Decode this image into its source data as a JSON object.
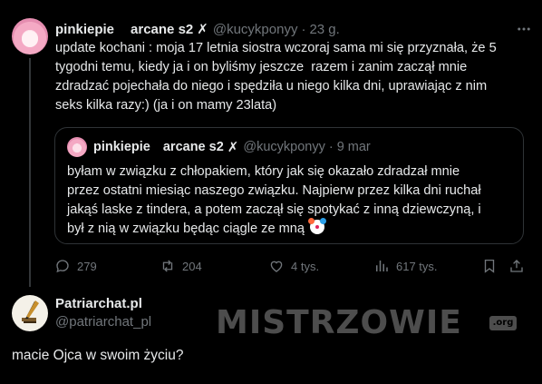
{
  "tweet": {
    "author_name": "pinkiepie",
    "author_alias": "arcane s2",
    "x_mark": "✗",
    "handle": "@kucykponyy",
    "separator": "·",
    "time": "23 g.",
    "text": "update kochani : moja 17 letnia siostra wczoraj sama mi się przyznała, że 5\ntygodni temu, kiedy ja i on byliśmy jeszcze  razem i zanim zaczął mnie\nzdradzać pojechała do niego i spędziła u niego kilka dni, uprawiając z nim\nseks kilka razy:) (ja i on mamy 23lata)",
    "quote": {
      "author_name": "pinkiepie",
      "author_alias": "arcane s2",
      "x_mark": "✗",
      "handle": "@kucykponyy",
      "separator": "·",
      "time": "9 mar",
      "text": "byłam w związku z chłopakiem, który jak się okazało zdradzał mnie\nprzez ostatni miesiąc naszego związku. Najpierw przez kilka dni ruchał\njakąś laske z tindera, a potem zaczął się spotykać z inną dziewczyną, i\nbył z nią w związku będąc ciągle ze mną",
      "emoji_icon": "clown-face-icon"
    },
    "actions": {
      "replies": "279",
      "reposts": "204",
      "likes": "4 tys.",
      "views": "617 tys."
    }
  },
  "reply": {
    "author_name": "Patriarchat.pl",
    "handle": "@patriarchat_pl",
    "text": "macie Ojca w swoim życiu?"
  },
  "watermark": {
    "text": "MISTRZOWIE",
    "badge": ".org"
  },
  "colors": {
    "background": "#000000",
    "text": "#e7e9ea",
    "muted": "#71767b",
    "border": "#2f3336"
  }
}
